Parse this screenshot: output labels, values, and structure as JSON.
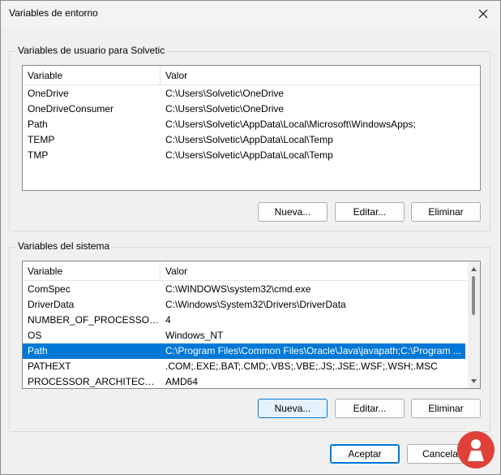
{
  "window": {
    "title": "Variables de entorno"
  },
  "user_group": {
    "label": "Variables de usuario para Solvetic",
    "columns": [
      "Variable",
      "Valor"
    ],
    "rows": [
      {
        "variable": "OneDrive",
        "value": "C:\\Users\\Solvetic\\OneDrive"
      },
      {
        "variable": "OneDriveConsumer",
        "value": "C:\\Users\\Solvetic\\OneDrive"
      },
      {
        "variable": "Path",
        "value": "C:\\Users\\Solvetic\\AppData\\Local\\Microsoft\\WindowsApps;"
      },
      {
        "variable": "TEMP",
        "value": "C:\\Users\\Solvetic\\AppData\\Local\\Temp"
      },
      {
        "variable": "TMP",
        "value": "C:\\Users\\Solvetic\\AppData\\Local\\Temp"
      }
    ],
    "buttons": {
      "new": "Nueva...",
      "edit": "Editar...",
      "delete": "Eliminar"
    }
  },
  "system_group": {
    "label": "Variables del sistema",
    "columns": [
      "Variable",
      "Valor"
    ],
    "rows": [
      {
        "variable": "ComSpec",
        "value": "C:\\WINDOWS\\system32\\cmd.exe"
      },
      {
        "variable": "DriverData",
        "value": "C:\\Windows\\System32\\Drivers\\DriverData"
      },
      {
        "variable": "NUMBER_OF_PROCESSORS",
        "value": "4"
      },
      {
        "variable": "OS",
        "value": "Windows_NT"
      },
      {
        "variable": "Path",
        "value": "C:\\Program Files\\Common Files\\Oracle\\Java\\javapath;C:\\Program ...",
        "selected": true
      },
      {
        "variable": "PATHEXT",
        "value": ".COM;.EXE;.BAT;.CMD;.VBS;.VBE;.JS;.JSE;.WSF;.WSH;.MSC"
      },
      {
        "variable": "PROCESSOR_ARCHITECTURE",
        "value": "AMD64"
      }
    ],
    "buttons": {
      "new": "Nueva...",
      "edit": "Editar...",
      "delete": "Eliminar"
    }
  },
  "footer": {
    "accept": "Aceptar",
    "cancel": "Cancelar"
  },
  "colors": {
    "selection": "#0078d7",
    "watermark": "#e0403a"
  }
}
